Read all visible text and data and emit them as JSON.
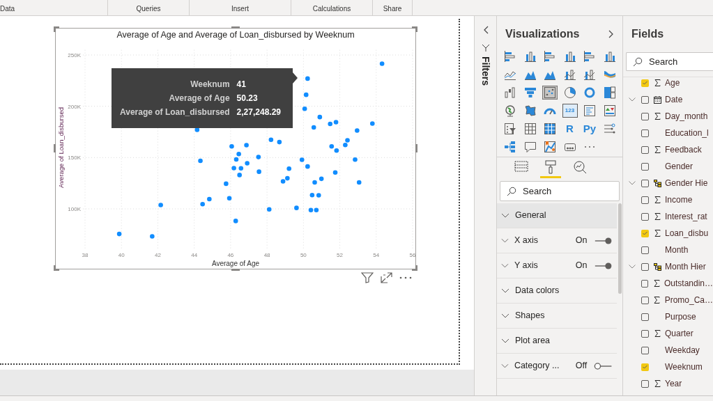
{
  "ribbon": {
    "groups": [
      {
        "label": "Data"
      },
      {
        "label": "Queries"
      },
      {
        "label": "Insert"
      },
      {
        "label": "Calculations"
      },
      {
        "label": "Share"
      }
    ]
  },
  "visual": {
    "chart_data": {
      "type": "scatter",
      "title": "Average of Age and Average of Loan_disbursed by Weeknum",
      "xlabel": "Average of Age",
      "ylabel": "Average of Loan_disbursed",
      "grid": true,
      "xlim": [
        38,
        56
      ],
      "ylim": [
        60000,
        255000
      ],
      "xticks": [
        38,
        40,
        42,
        44,
        46,
        48,
        50,
        52,
        54,
        56
      ],
      "yticks": [
        {
          "value": 100000,
          "label": "100K"
        },
        {
          "value": 150000,
          "label": "150K"
        },
        {
          "value": 200000,
          "label": "200K"
        },
        {
          "value": 250000,
          "label": "250K"
        }
      ],
      "x": [
        54.32,
        50.23,
        50.15,
        50.07,
        50.9,
        51.47,
        51.79,
        53.79,
        50.57,
        52.95,
        44.16,
        48.22,
        48.68,
        52.42,
        52.3,
        46.87,
        46.06,
        51.55,
        51.82,
        46.45,
        47.53,
        44.34,
        46.31,
        46.91,
        49.92,
        52.84,
        50.23,
        46.18,
        46.57,
        49.21,
        46.49,
        47.56,
        51.75,
        45.75,
        48.88,
        49.12,
        50.62,
        50.99,
        53.06,
        50.48,
        50.84,
        45.93,
        44.83,
        44.46,
        42.16,
        48.12,
        49.62,
        50.41,
        50.71,
        46.28,
        39.88,
        41.69
      ],
      "series": [
        {
          "color": "#118dff",
          "values": [
            241500,
            227000,
            211200,
            197600,
            189500,
            182800,
            184500,
            183100,
            179400,
            176400,
            177100,
            167400,
            165100,
            166900,
            162300,
            162100,
            160900,
            160900,
            156800,
            153500,
            150500,
            146800,
            148200,
            144500,
            147800,
            148000,
            141300,
            139700,
            139500,
            139200,
            133000,
            136200,
            135500,
            124500,
            126800,
            129800,
            125800,
            129300,
            125800,
            113400,
            113200,
            110400,
            109500,
            104600,
            103700,
            99500,
            100900,
            98800,
            98800,
            88200,
            75500,
            73200
          ]
        }
      ]
    },
    "tooltip": [
      {
        "label": "Weeknum",
        "value": "41"
      },
      {
        "label": "Average of Age",
        "value": "50.23"
      },
      {
        "label": "Average of Loan_disbursed",
        "value": "2,27,248.29"
      }
    ]
  },
  "filters_pane": {
    "title": "Filters"
  },
  "visualizations": {
    "title": "Visualizations",
    "types": [
      {
        "kind": "hbar",
        "selected": false
      },
      {
        "kind": "vbar",
        "selected": false
      },
      {
        "kind": "hbar",
        "selected": false
      },
      {
        "kind": "vbar",
        "selected": false
      },
      {
        "kind": "hbar",
        "selected": false
      },
      {
        "kind": "vbar",
        "selected": false
      },
      {
        "kind": "line",
        "selected": false
      },
      {
        "kind": "area",
        "selected": false
      },
      {
        "kind": "area",
        "selected": false
      },
      {
        "kind": "combo",
        "selected": false
      },
      {
        "kind": "combo",
        "selected": false
      },
      {
        "kind": "ribbon",
        "selected": false
      },
      {
        "kind": "waterfall",
        "selected": false
      },
      {
        "kind": "funnel",
        "selected": false
      },
      {
        "kind": "scatter",
        "selected": true
      },
      {
        "kind": "pie",
        "selected": false
      },
      {
        "kind": "donut",
        "selected": false
      },
      {
        "kind": "treemap",
        "selected": false
      },
      {
        "kind": "globe",
        "selected": false
      },
      {
        "kind": "filledmap",
        "selected": false
      },
      {
        "kind": "gauge",
        "selected": false
      },
      {
        "kind": "card",
        "glyph": "123",
        "selected": false
      },
      {
        "kind": "multicard",
        "selected": false
      },
      {
        "kind": "kpi",
        "selected": false
      },
      {
        "kind": "slicer",
        "selected": false
      },
      {
        "kind": "table",
        "selected": false
      },
      {
        "kind": "matrix",
        "selected": false
      },
      {
        "kind": "script",
        "glyph": "R",
        "selected": false
      },
      {
        "kind": "script",
        "glyph": "Py",
        "selected": false
      },
      {
        "kind": "influencers",
        "selected": false
      },
      {
        "kind": "decomposition",
        "selected": false
      },
      {
        "kind": "speech",
        "selected": false
      },
      {
        "kind": "arcmap",
        "selected": false
      },
      {
        "kind": "narrative",
        "selected": false
      },
      {
        "kind": "more",
        "selected": false
      }
    ],
    "pane_tabs": [
      {
        "kind": "fields",
        "selected": false
      },
      {
        "kind": "format",
        "selected": true
      },
      {
        "kind": "analytics",
        "selected": false
      }
    ],
    "search": {
      "placeholder": "Search"
    },
    "sections": [
      {
        "label": "General",
        "highlighted": true
      },
      {
        "label": "X axis",
        "highlighted": false,
        "toggle": {
          "label": "On",
          "on": true
        }
      },
      {
        "label": "Y axis",
        "highlighted": false,
        "toggle": {
          "label": "On",
          "on": true
        }
      },
      {
        "label": "Data colors",
        "highlighted": false
      },
      {
        "label": "Shapes",
        "highlighted": false
      },
      {
        "label": "Plot area",
        "highlighted": false
      },
      {
        "label": "Category ...",
        "highlighted": false,
        "toggle": {
          "label": "Off",
          "on": false
        }
      }
    ]
  },
  "fields": {
    "title": "Fields",
    "search": {
      "placeholder": "Search"
    },
    "items": [
      {
        "name": "Age",
        "kind": "measure",
        "checked": true,
        "expandable": false
      },
      {
        "name": "Date",
        "kind": "date",
        "checked": false,
        "expandable": true
      },
      {
        "name": "Day_month",
        "kind": "measure",
        "checked": false,
        "expandable": false
      },
      {
        "name": "Education_l",
        "kind": "text",
        "checked": false,
        "expandable": false
      },
      {
        "name": "Feedback",
        "kind": "measure",
        "checked": false,
        "expandable": false
      },
      {
        "name": "Gender",
        "kind": "text",
        "checked": false,
        "expandable": false
      },
      {
        "name": "Gender Hie",
        "kind": "hierarchy",
        "checked": false,
        "expandable": true
      },
      {
        "name": "Income",
        "kind": "measure",
        "checked": false,
        "expandable": false
      },
      {
        "name": "Interest_rat",
        "kind": "measure",
        "checked": false,
        "expandable": false
      },
      {
        "name": "Loan_disbu",
        "kind": "measure",
        "checked": true,
        "expandable": false
      },
      {
        "name": "Month",
        "kind": "text",
        "checked": false,
        "expandable": false
      },
      {
        "name": "Month Hier",
        "kind": "hierarchy",
        "checked": false,
        "expandable": true
      },
      {
        "name": "Outstandin…",
        "kind": "measure",
        "checked": false,
        "expandable": false
      },
      {
        "name": "Promo_Ca…",
        "kind": "measure",
        "checked": false,
        "expandable": false
      },
      {
        "name": "Purpose",
        "kind": "text",
        "checked": false,
        "expandable": false
      },
      {
        "name": "Quarter",
        "kind": "measure",
        "checked": false,
        "expandable": false
      },
      {
        "name": "Weekday",
        "kind": "text",
        "checked": false,
        "expandable": false
      },
      {
        "name": "Weeknum",
        "kind": "text",
        "checked": true,
        "expandable": false
      },
      {
        "name": "Year",
        "kind": "measure",
        "checked": false,
        "expandable": false
      }
    ]
  }
}
